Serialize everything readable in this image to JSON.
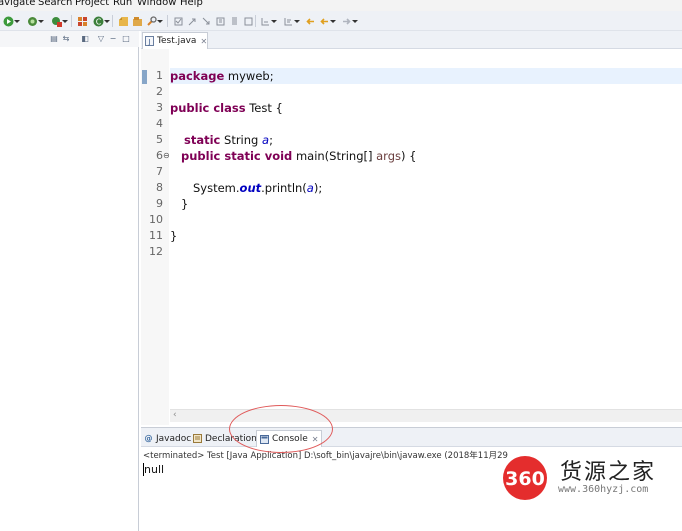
{
  "menubar": {
    "items": [
      "avigate",
      "Search",
      "Project",
      "Run",
      "Window",
      "Help"
    ]
  },
  "editor": {
    "tab_label": "Test.java",
    "line_numbers": [
      "1",
      "2",
      "3",
      "4",
      "5",
      "6",
      "7",
      "8",
      "9",
      "10",
      "11",
      "12"
    ],
    "fold_marker": "⊖",
    "code": {
      "l1_kw": "package",
      "l1_rest": " myweb;",
      "l3_kw": "public class",
      "l3_rest": " Test {",
      "l5_kw": "static",
      "l5_type": " String ",
      "l5_field": "a",
      "l5_end": ";",
      "l6_kw": "public static void",
      "l6_sig": " main(String[] ",
      "l6_param": "args",
      "l6_end": ") {",
      "l8_obj": "System.",
      "l8_out": "out",
      "l8_call": ".println(",
      "l8_arg": "a",
      "l8_end": ");",
      "l9": "}",
      "l11": "}"
    }
  },
  "bottom": {
    "tabs": {
      "javadoc": "Javadoc",
      "declaration": "Declaration",
      "console": "Console"
    },
    "console_label": "<terminated> Test [Java Application] D:\\soft_bin\\javajre\\bin\\javaw.exe (2018年11月29",
    "output": "null"
  },
  "watermark": {
    "badge": "360",
    "title": "货源之家",
    "url": "www.360hyzj.com"
  },
  "colors": {
    "keyword": "#7f0055",
    "field": "#0000c0",
    "highlight_circle": "#e05a5a",
    "badge_red": "#e42d2d"
  }
}
